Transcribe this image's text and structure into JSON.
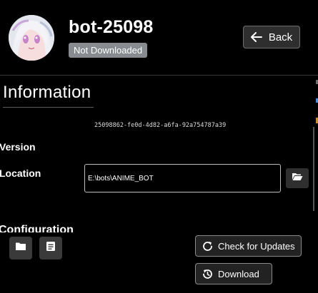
{
  "bot": {
    "name": "bot-25098",
    "status": "Not Downloaded",
    "uuid": "25098862-fe0d-4d82-a6fa-92a754787a39"
  },
  "header": {
    "back_label": "Back"
  },
  "info": {
    "heading": "Information",
    "version_label": "Version",
    "location_label": "Location",
    "location_value": "E:\\bots\\ANIME_BOT",
    "config_label": "Configuration"
  },
  "actions": {
    "check_updates_label": "Check for Updates",
    "download_label": "Download"
  },
  "colors": {
    "background": "#000000",
    "badge": "#888b8f",
    "button": "#2e2e2e",
    "border": "#8a8a8a"
  },
  "icons": [
    "arrow-left-icon",
    "folder-open-icon",
    "folder-icon",
    "document-icon",
    "refresh-icon",
    "history-icon"
  ]
}
